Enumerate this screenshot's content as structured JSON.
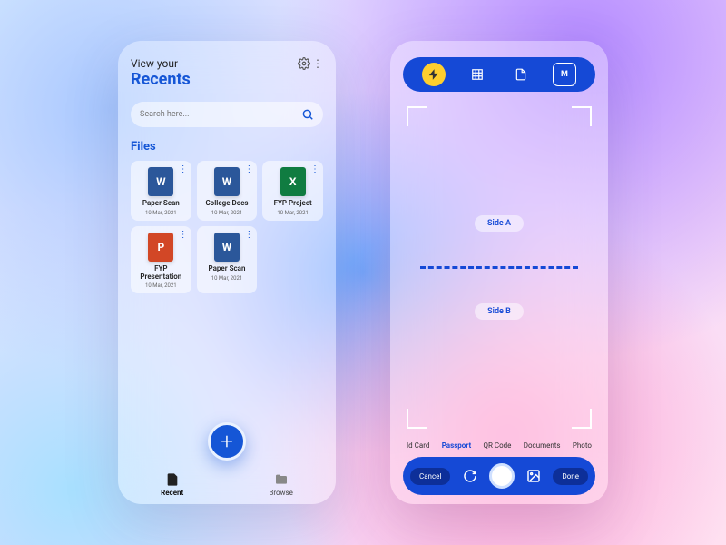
{
  "left": {
    "subtitle": "View your",
    "title": "Recents",
    "search_placeholder": "Search here...",
    "files_label": "Files",
    "files": [
      {
        "name": "Paper Scan",
        "date": "10 Mar, 2021",
        "type": "word"
      },
      {
        "name": "College Docs",
        "date": "10 Mar, 2021",
        "type": "word"
      },
      {
        "name": "FYP Project",
        "date": "10 Mar, 2021",
        "type": "excel"
      },
      {
        "name": "FYP Presentation",
        "date": "10 Mar, 2021",
        "type": "ppt"
      },
      {
        "name": "Paper Scan",
        "date": "10 Mar, 2021",
        "type": "word"
      }
    ],
    "tab_recent": "Recent",
    "tab_browse": "Browse"
  },
  "right": {
    "side_a": "Side A",
    "side_b": "Side B",
    "modes": [
      "Id Card",
      "Passport",
      "QR Code",
      "Documents",
      "Photo"
    ],
    "active_mode_index": 1,
    "cancel": "Cancel",
    "done": "Done"
  }
}
